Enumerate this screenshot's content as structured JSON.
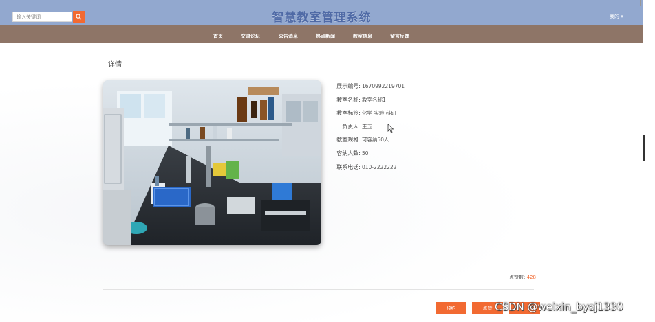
{
  "header": {
    "search_placeholder": "输入关键词",
    "site_title": "智慧教室管理系统",
    "user_menu": "我的 ▾"
  },
  "nav": {
    "items": [
      {
        "label": "首页"
      },
      {
        "label": "交流论坛"
      },
      {
        "label": "公告消息"
      },
      {
        "label": "热点新闻"
      },
      {
        "label": "教室信息"
      },
      {
        "label": "留言反馈"
      }
    ]
  },
  "detail": {
    "section_title": "详情",
    "photo_alt": "实验室照片",
    "fields": [
      {
        "label": "展示编号:",
        "value": "1670992219701"
      },
      {
        "label": "教室名称:",
        "value": "教室名称1"
      },
      {
        "label": "教室标签:",
        "value": "化学 实验 科研"
      },
      {
        "label": "负责人:",
        "value": "王五"
      },
      {
        "label": "教室规格:",
        "value": "可容纳50人"
      },
      {
        "label": "容纳人数:",
        "value": "50"
      },
      {
        "label": "联系电话:",
        "value": "010-2222222"
      }
    ],
    "likes_label": "点赞数:",
    "likes_count": "428"
  },
  "actions": {
    "book_button": "预约",
    "like_button": "点赞"
  },
  "watermark": "CSDN @weixin_bysj1330",
  "colors": {
    "topbar": "#92a8cf",
    "navbar": "#8e7567",
    "accent": "#f26a32",
    "title_text": "#4f6aa6"
  }
}
